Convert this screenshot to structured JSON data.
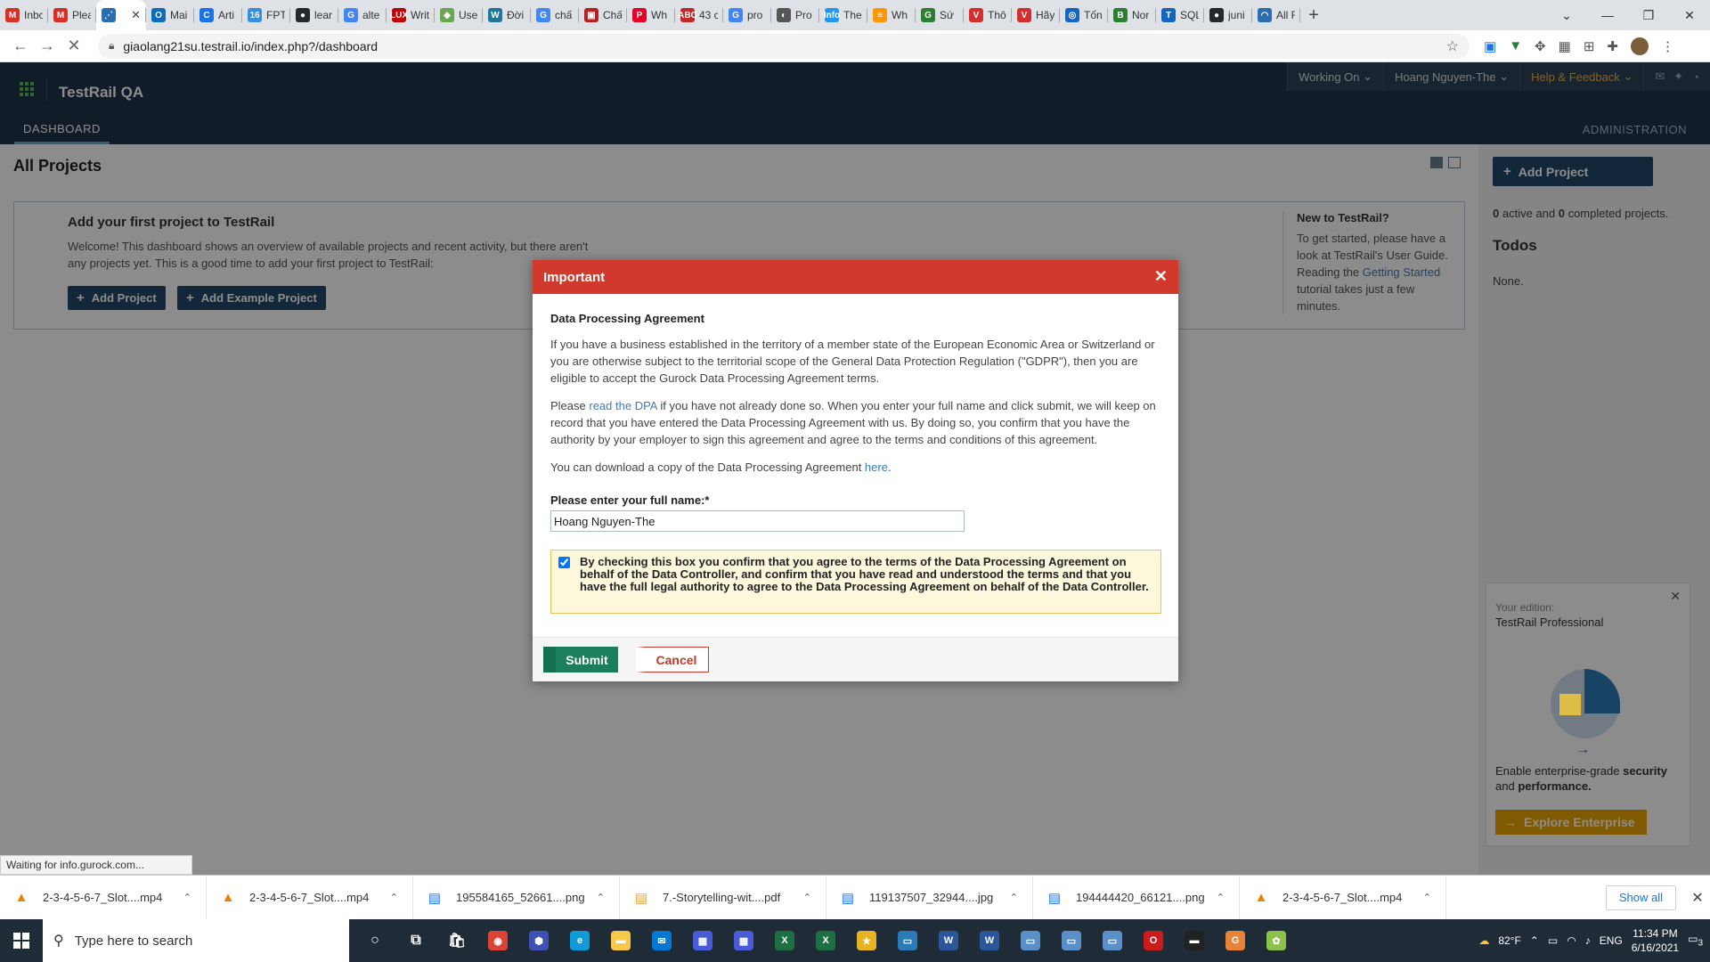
{
  "browser": {
    "tabs": [
      {
        "label": "Inbo",
        "color": "#d93025",
        "glyph": "M"
      },
      {
        "label": "Plea",
        "color": "#d93025",
        "glyph": "M"
      },
      {
        "label": "",
        "color": "#2a6db0",
        "glyph": "⋰",
        "active": true
      },
      {
        "label": "Mai",
        "color": "#0f6cbd",
        "glyph": "O"
      },
      {
        "label": "Arti",
        "color": "#1a73e8",
        "glyph": "C"
      },
      {
        "label": "FPT",
        "color": "#3a8dde",
        "glyph": "16"
      },
      {
        "label": "lear",
        "color": "#24292e",
        "glyph": "●"
      },
      {
        "label": "alte",
        "color": "#4285f4",
        "glyph": "G"
      },
      {
        "label": "Writ",
        "color": "#c00000",
        "glyph": "LUX"
      },
      {
        "label": "Use",
        "color": "#6aa84f",
        "glyph": "◆"
      },
      {
        "label": "Đời",
        "color": "#21759b",
        "glyph": "W"
      },
      {
        "label": "chấ",
        "color": "#4285f4",
        "glyph": "G"
      },
      {
        "label": "Chấ",
        "color": "#b22222",
        "glyph": "▣"
      },
      {
        "label": "Wh",
        "color": "#e60023",
        "glyph": "P"
      },
      {
        "label": "43 c",
        "color": "#c62828",
        "glyph": "ABC"
      },
      {
        "label": "pro",
        "color": "#4285f4",
        "glyph": "G"
      },
      {
        "label": "Pro",
        "color": "#555555",
        "glyph": "◐"
      },
      {
        "label": "The",
        "color": "#2196f3",
        "glyph": "Info"
      },
      {
        "label": "Wh",
        "color": "#ff9800",
        "glyph": "≡"
      },
      {
        "label": "Sứ",
        "color": "#2e7d32",
        "glyph": "G"
      },
      {
        "label": "Thô",
        "color": "#d32f2f",
        "glyph": "V"
      },
      {
        "label": "Hãy",
        "color": "#d32f2f",
        "glyph": "V"
      },
      {
        "label": "Tốn",
        "color": "#1565c0",
        "glyph": "◎"
      },
      {
        "label": "Nor",
        "color": "#2e7d32",
        "glyph": "B"
      },
      {
        "label": "SQL",
        "color": "#1565c0",
        "glyph": "T"
      },
      {
        "label": "juni",
        "color": "#24292e",
        "glyph": "●"
      },
      {
        "label": "All F",
        "color": "#2a6db0",
        "glyph": "◠"
      }
    ],
    "url": "giaolang21su.testrail.io/index.php?/dashboard",
    "status_text": "Waiting for info.gurock.com..."
  },
  "app": {
    "name": "TestRail QA",
    "topnav": {
      "working_on": "Working On",
      "user": "Hoang Nguyen-The",
      "help": "Help & Feedback"
    },
    "tab_dashboard": "DASHBOARD",
    "tab_admin": "ADMINISTRATION"
  },
  "dashboard": {
    "title": "All Projects",
    "intro_title": "Add your first project to TestRail",
    "intro_text": "Welcome! This dashboard shows an overview of available projects and recent activity, but there aren't any projects yet. This is a good time to add your first project to TestRail:",
    "add_project": "Add Project",
    "add_example": "Add Example Project",
    "new_title": "New to TestRail?",
    "new_text_1": "To get started, please have a look at TestRail's User Guide. Reading the ",
    "new_link": "Getting Started",
    "new_text_2": " tutorial takes just a few minutes."
  },
  "sidebar": {
    "add_project": "Add Project",
    "stats_active": "0",
    "stats_mid": " active and ",
    "stats_completed": "0",
    "stats_end": " completed projects.",
    "todos": "Todos",
    "none": "None.",
    "edition_label": "Your edition:",
    "edition_name": "TestRail Professional",
    "edition_text_1": "Enable enterprise-grade ",
    "edition_bold_1": "security",
    "edition_text_2": " and ",
    "edition_bold_2": "performance.",
    "explore": "Explore Enterprise"
  },
  "modal": {
    "title": "Important",
    "heading": "Data Processing Agreement",
    "para1": "If you have a business established in the territory of a member state of the European Economic Area or Switzerland or you are otherwise subject to the territorial scope of the General Data Protection Regulation (\"GDPR\"), then you are eligible to accept the Gurock Data Processing Agreement terms.",
    "para2_a": "Please ",
    "para2_link": "read the DPA",
    "para2_b": " if you have not already done so. When you enter your full name and click submit, we will keep on record that you have entered the Data Processing Agreement with us. By doing so, you confirm that you have the authority by your employer to sign this agreement and agree to the terms and conditions of this agreement.",
    "para3_a": "You can download a copy of the Data Processing Agreement ",
    "para3_link": "here",
    "para3_b": ".",
    "name_label": "Please enter your full name:*",
    "name_value": "Hoang Nguyen-The",
    "agree_text": "By checking this box you confirm that you agree to the terms of the Data Processing Agreement on behalf of the Data Controller, and confirm that you have read and understood the terms and that you have the full legal authority to agree to the Data Processing Agreement on behalf of the Data Controller.",
    "agree_checked": true,
    "submit": "Submit",
    "cancel": "Cancel"
  },
  "downloads": {
    "items": [
      {
        "name": "2-3-4-5-6-7_Slot....mp4",
        "icon": "vlc-icon",
        "glyph": "▲",
        "color": "#f08000"
      },
      {
        "name": "2-3-4-5-6-7_Slot....mp4",
        "icon": "vlc-icon",
        "glyph": "▲",
        "color": "#f08000"
      },
      {
        "name": "195584165_52661....png",
        "icon": "image-file-icon",
        "glyph": "▤",
        "color": "#1a73e8"
      },
      {
        "name": "7.-Storytelling-wit....pdf",
        "icon": "pdf-file-icon",
        "glyph": "▤",
        "color": "#e8a33c"
      },
      {
        "name": "119137507_32944....jpg",
        "icon": "image-file-icon",
        "glyph": "▤",
        "color": "#1a73e8"
      },
      {
        "name": "194444420_66121....png",
        "icon": "image-file-icon",
        "glyph": "▤",
        "color": "#1a73e8"
      },
      {
        "name": "2-3-4-5-6-7_Slot....mp4",
        "icon": "vlc-icon",
        "glyph": "▲",
        "color": "#f08000"
      }
    ],
    "show_all": "Show all"
  },
  "taskbar": {
    "search_placeholder": "Type here to search",
    "apps": [
      {
        "name": "cortana-icon",
        "glyph": "○",
        "color": ""
      },
      {
        "name": "task-view-icon",
        "glyph": "⧉",
        "color": ""
      },
      {
        "name": "store-icon",
        "glyph": "🛍",
        "color": ""
      },
      {
        "name": "chrome-icon",
        "glyph": "◉",
        "color": "#db4437"
      },
      {
        "name": "app-icon",
        "glyph": "⬢",
        "color": "#3f51b5"
      },
      {
        "name": "edge-icon",
        "glyph": "e",
        "color": "#0f9bd7"
      },
      {
        "name": "folder-icon",
        "glyph": "▬",
        "color": "#f7c948"
      },
      {
        "name": "mail-icon",
        "glyph": "✉",
        "color": "#0078d4"
      },
      {
        "name": "app-icon-2",
        "glyph": "▦",
        "color": "#4a5bd8"
      },
      {
        "name": "app-icon-3",
        "glyph": "▦",
        "color": "#4a5bd8"
      },
      {
        "name": "excel-icon",
        "glyph": "X",
        "color": "#1d7044"
      },
      {
        "name": "excel-icon-2",
        "glyph": "X",
        "color": "#1d7044"
      },
      {
        "name": "star-app-icon",
        "glyph": "★",
        "color": "#e6b422"
      },
      {
        "name": "remote-icon",
        "glyph": "▭",
        "color": "#2b7bb9"
      },
      {
        "name": "word-icon",
        "glyph": "W",
        "color": "#2b579a"
      },
      {
        "name": "word-icon-2",
        "glyph": "W",
        "color": "#2b579a"
      },
      {
        "name": "window-icon",
        "glyph": "▭",
        "color": "#5b8fc7"
      },
      {
        "name": "window-icon-2",
        "glyph": "▭",
        "color": "#5b8fc7"
      },
      {
        "name": "window-icon-3",
        "glyph": "▭",
        "color": "#5b8fc7"
      },
      {
        "name": "opera-icon",
        "glyph": "O",
        "color": "#cc1b1b"
      },
      {
        "name": "terminal-icon",
        "glyph": "▬",
        "color": "#222"
      },
      {
        "name": "chrome-app-icon",
        "glyph": "G",
        "color": "#e8833a"
      },
      {
        "name": "paint-icon",
        "glyph": "✿",
        "color": "#8bc34a"
      }
    ],
    "weather": "82°F",
    "lang": "ENG",
    "time": "11:34 PM",
    "date": "6/16/2021",
    "notifications": "3"
  }
}
